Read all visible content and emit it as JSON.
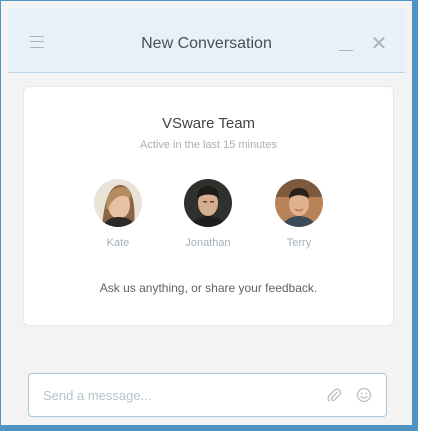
{
  "header": {
    "title": "New Conversation",
    "menu_icon": "hamburger-menu-icon",
    "minimize_icon": "minimize-icon",
    "close_icon": "close-icon",
    "close_glyph": "✕"
  },
  "team": {
    "name": "VSware Team",
    "status": "Active in the last 15 minutes",
    "members": [
      {
        "name": "Kate",
        "avatar_color": "#9b7a5c"
      },
      {
        "name": "Jonathan",
        "avatar_color": "#3d3f3c"
      },
      {
        "name": "Terry",
        "avatar_color": "#8a6a4d"
      }
    ],
    "tagline": "Ask us anything, or share your feedback."
  },
  "composer": {
    "placeholder": "Send a message...",
    "value": "",
    "attach_icon": "paperclip-icon",
    "emoji_icon": "smiley-icon"
  },
  "colors": {
    "header_bg": "#e6f1f8",
    "frame_border": "#4f94c2",
    "panel_bg": "#f3f3f3"
  }
}
